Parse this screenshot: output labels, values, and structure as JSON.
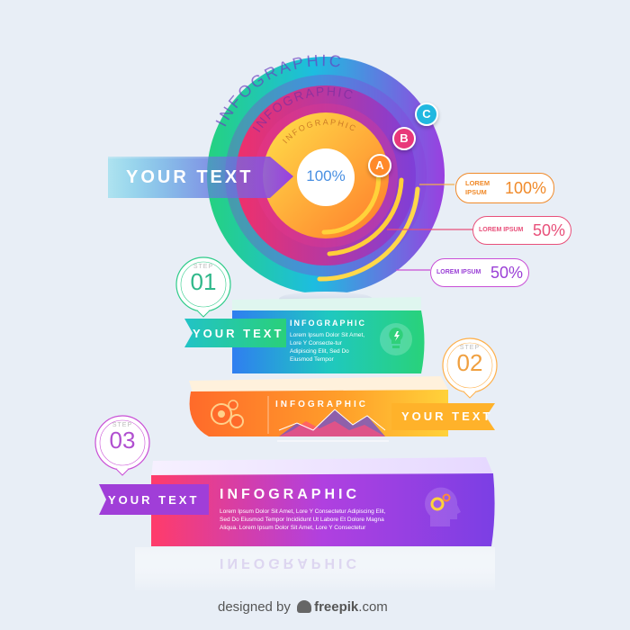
{
  "rings": {
    "outer_title": "INFOGRAPHIC",
    "middle_title": "INFOGRAPHIC",
    "inner_title": "INFOGRAPHIC",
    "center_value": "100%",
    "badge_a": "A",
    "badge_b": "B",
    "badge_c": "C"
  },
  "top_ribbon": {
    "text": "YOUR TEXT"
  },
  "stats": [
    {
      "label": "LOREM IPSUM",
      "value": "100%",
      "color": "#f08a2a"
    },
    {
      "label": "LOREM IPSUM",
      "value": "50%",
      "color": "#e8507a"
    },
    {
      "label": "LOREM IPSUM",
      "value": "50%",
      "color": "#c94fd6"
    }
  ],
  "steps": [
    {
      "step_label": "STEP",
      "number": "01",
      "ribbon": "YOUR TEXT",
      "title": "INFOGRAPHIC",
      "body": "Lorem Ipsum Dolor Sit Amet, Lore Y Consecte-tur Adipiscing Elit, Sed Do Eiusmod Tempor",
      "icon": "lightbulb-icon"
    },
    {
      "step_label": "STEP",
      "number": "02",
      "ribbon": "YOUR TEXT",
      "title": "INFOGRAPHIC",
      "icon": "gears-icon"
    },
    {
      "step_label": "STEP",
      "number": "03",
      "ribbon": "YOUR TEXT",
      "title": "INFOGRAPHIC",
      "body": "Lorem Ipsum Dolor Sit Amet, Lore Y Consectetur Adipiscing Elit, Sed Do Eiusmod Tempor Incididunt Ut Labore Et Dolore Magna Aliqua. Lorem Ipsum Dolor Sit Amet, Lore Y Consectetur",
      "icon": "head-gears-icon"
    }
  ],
  "reflection": {
    "title": "INFOGRAPHIC"
  },
  "footer": {
    "designed_by": "designed by",
    "brand": "freepik",
    "domain": ".com"
  }
}
